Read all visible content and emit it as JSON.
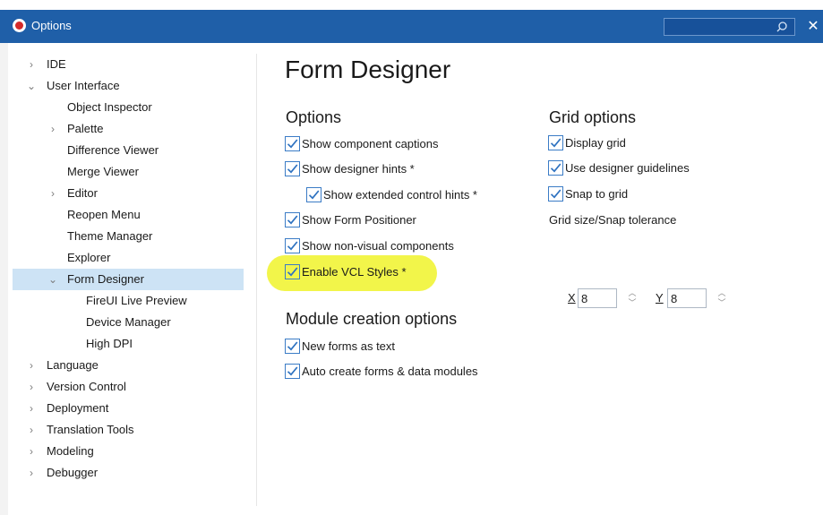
{
  "window": {
    "title": "Options",
    "search_placeholder": "",
    "close_glyph": "✕"
  },
  "nav": {
    "items": [
      {
        "label": "IDE",
        "chevron": "›"
      },
      {
        "label": "User Interface",
        "chevron": "⌄"
      },
      {
        "label": "Object Inspector",
        "chevron": ""
      },
      {
        "label": "Palette",
        "chevron": "›"
      },
      {
        "label": "Difference Viewer",
        "chevron": ""
      },
      {
        "label": "Merge Viewer",
        "chevron": ""
      },
      {
        "label": "Editor",
        "chevron": "›"
      },
      {
        "label": "Reopen Menu",
        "chevron": ""
      },
      {
        "label": "Theme Manager",
        "chevron": ""
      },
      {
        "label": "Explorer",
        "chevron": ""
      },
      {
        "label": "Form Designer",
        "chevron": "⌄",
        "selected": true
      },
      {
        "label": "FireUI Live Preview",
        "chevron": ""
      },
      {
        "label": "Device Manager",
        "chevron": ""
      },
      {
        "label": "High DPI",
        "chevron": ""
      },
      {
        "label": "Language",
        "chevron": "›"
      },
      {
        "label": "Version Control",
        "chevron": "›"
      },
      {
        "label": "Deployment",
        "chevron": "›"
      },
      {
        "label": "Translation Tools",
        "chevron": "›"
      },
      {
        "label": "Modeling",
        "chevron": "›"
      },
      {
        "label": "Debugger",
        "chevron": "›"
      }
    ]
  },
  "main": {
    "title": "Form Designer",
    "options": {
      "heading": "Options",
      "items": [
        {
          "label": "Show component captions",
          "checked": true
        },
        {
          "label": "Show designer hints *",
          "checked": true
        },
        {
          "label": "Show extended control hints *",
          "checked": true
        },
        {
          "label": "Show Form Positioner",
          "checked": true
        },
        {
          "label": "Show non-visual components",
          "checked": true
        },
        {
          "label": "Enable VCL Styles *",
          "checked": true,
          "highlighted": true
        }
      ]
    },
    "grid_options": {
      "heading": "Grid options",
      "items": [
        {
          "label": "Display grid",
          "checked": true
        },
        {
          "label": "Use designer guidelines",
          "checked": true
        },
        {
          "label": "Snap to grid",
          "checked": true
        }
      ],
      "size_label": "Grid size/Snap tolerance",
      "x_label": "X",
      "x_value": "8",
      "y_label": "Y",
      "y_value": "8"
    },
    "module_creation": {
      "heading": "Module creation options",
      "items": [
        {
          "label": "New forms as text",
          "checked": true
        },
        {
          "label": "Auto create forms & data modules",
          "checked": true
        }
      ]
    }
  },
  "colors": {
    "titlebar": "#1f5fa8",
    "checkbox_accent": "#3b7cc6",
    "selection": "#cde3f5",
    "highlight": "#f2f54a"
  },
  "icons": {
    "app": "app-icon",
    "search": "search-icon",
    "close": "close-icon",
    "expand": "chevron-right-icon",
    "collapse": "chevron-down-icon",
    "check": "checkmark-icon"
  }
}
